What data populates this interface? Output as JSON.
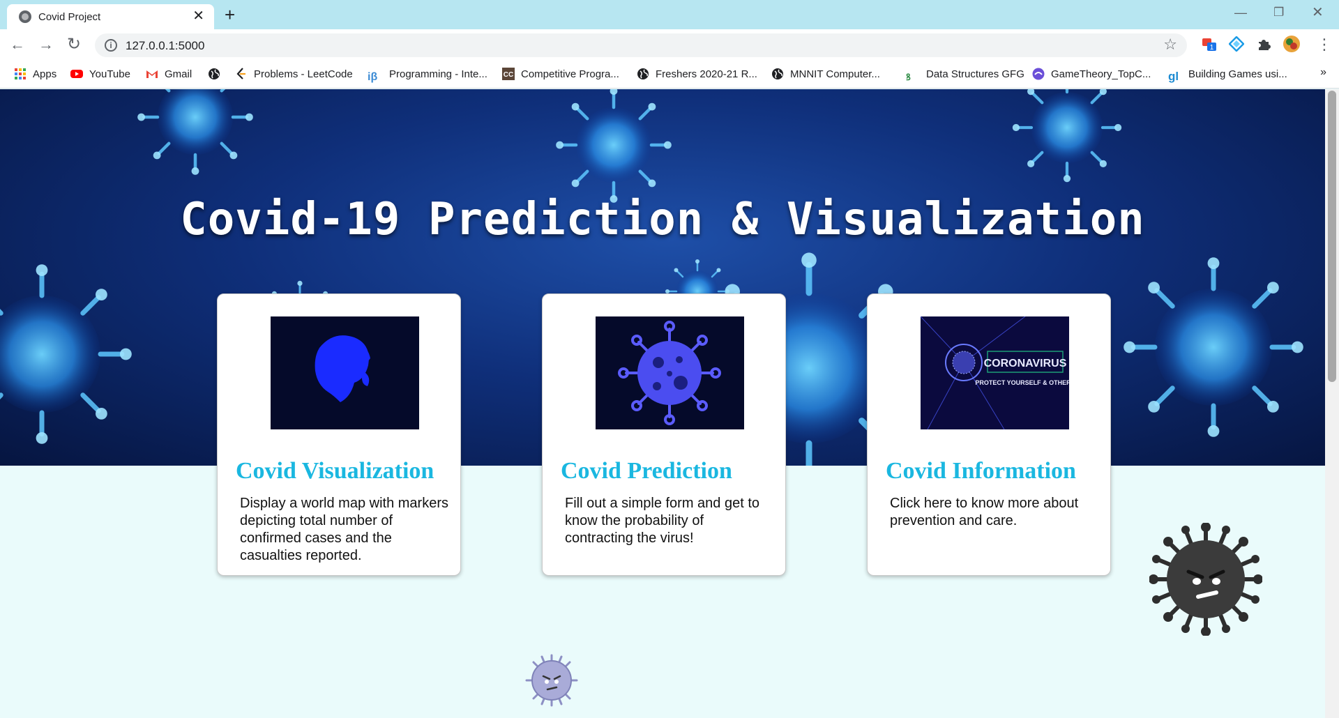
{
  "browser": {
    "tab_title": "Covid Project",
    "tab_close": "✕",
    "new_tab": "+",
    "url": "127.0.0.1:5000",
    "more_bookmarks": "»",
    "bookmarks": [
      {
        "label": "Apps",
        "icon": "apps-grid-icon"
      },
      {
        "label": "YouTube",
        "icon": "youtube-icon"
      },
      {
        "label": "Gmail",
        "icon": "gmail-icon"
      },
      {
        "label": "",
        "icon": "globe-icon"
      },
      {
        "label": "Problems - LeetCode",
        "icon": "leetcode-icon"
      },
      {
        "label": "Programming - Inte...",
        "icon": "interviewbit-icon"
      },
      {
        "label": "Competitive Progra...",
        "icon": "codechef-icon"
      },
      {
        "label": "Freshers 2020-21 R...",
        "icon": "globe-icon"
      },
      {
        "label": "MNNIT Computer...",
        "icon": "globe-icon"
      },
      {
        "label": "Data Structures GFG",
        "icon": "gfg-icon"
      },
      {
        "label": "GameTheory_TopC...",
        "icon": "topcoder-icon"
      },
      {
        "label": "Building Games usi...",
        "icon": "gl-icon"
      }
    ],
    "extension_badge": "1"
  },
  "hero": {
    "title": "Covid-19 Prediction & Visualization"
  },
  "cards": [
    {
      "title": "Covid Visualization",
      "description": "Display a world map with markers depicting total number of confirmed cases and the casualties reported.",
      "image": "world-map-image"
    },
    {
      "title": "Covid Prediction",
      "description": "Fill out a simple form and get to know the probability of contracting the virus!",
      "image": "virus-image"
    },
    {
      "title": "Covid Information",
      "description": "Click here to know more about prevention and care.",
      "image": "coronavirus-poster-image",
      "image_text_1": "CORONAVIRUS",
      "image_text_2": "PROTECT YOURSELF & OTHERS"
    }
  ],
  "colors": {
    "accent": "#1ab7e0",
    "hero_blue": "#0f2f7a",
    "page_bg": "#eafbfb",
    "tabbar": "#b7e6f1"
  }
}
